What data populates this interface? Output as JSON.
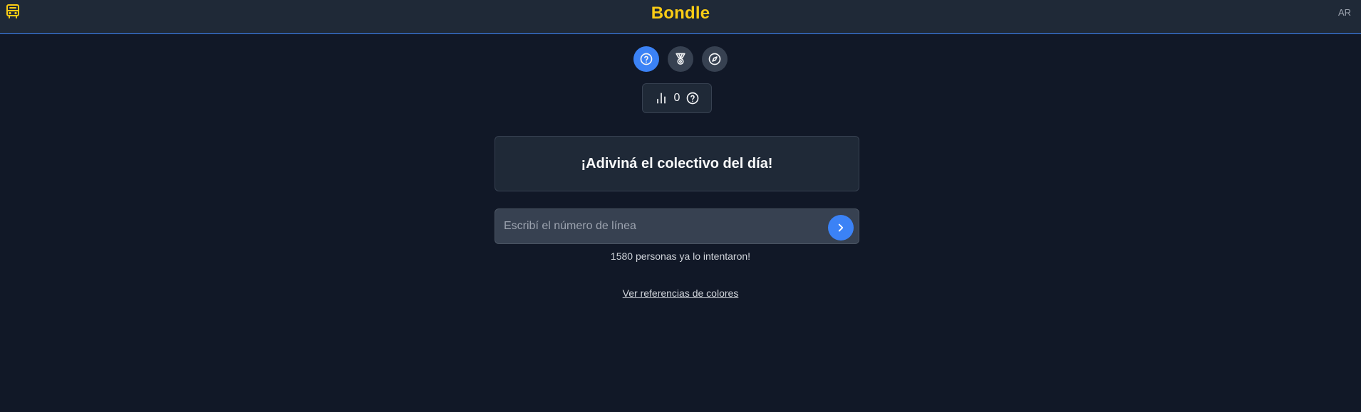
{
  "header": {
    "title": "Bondle",
    "language": "AR",
    "logo_icon": "bus-icon",
    "title_color": "#facc15",
    "accent_color": "#3b82f6"
  },
  "nav": {
    "items": [
      {
        "name": "help",
        "icon": "help-circle-icon",
        "active": true
      },
      {
        "name": "achievements",
        "icon": "medal-icon",
        "active": false
      },
      {
        "name": "explore",
        "icon": "compass-icon",
        "active": false
      }
    ]
  },
  "stats": {
    "icon": "bar-chart-icon",
    "count": "0",
    "help_icon": "help-circle-icon"
  },
  "main": {
    "headline": "¡Adiviná el colectivo del día!",
    "search_placeholder": "Escribí el número de línea",
    "search_value": "",
    "submit_icon": "chevron-right-icon",
    "attempts_text": "1580 personas ya lo intentaron!",
    "colors_link": "Ver referencias de colores"
  }
}
